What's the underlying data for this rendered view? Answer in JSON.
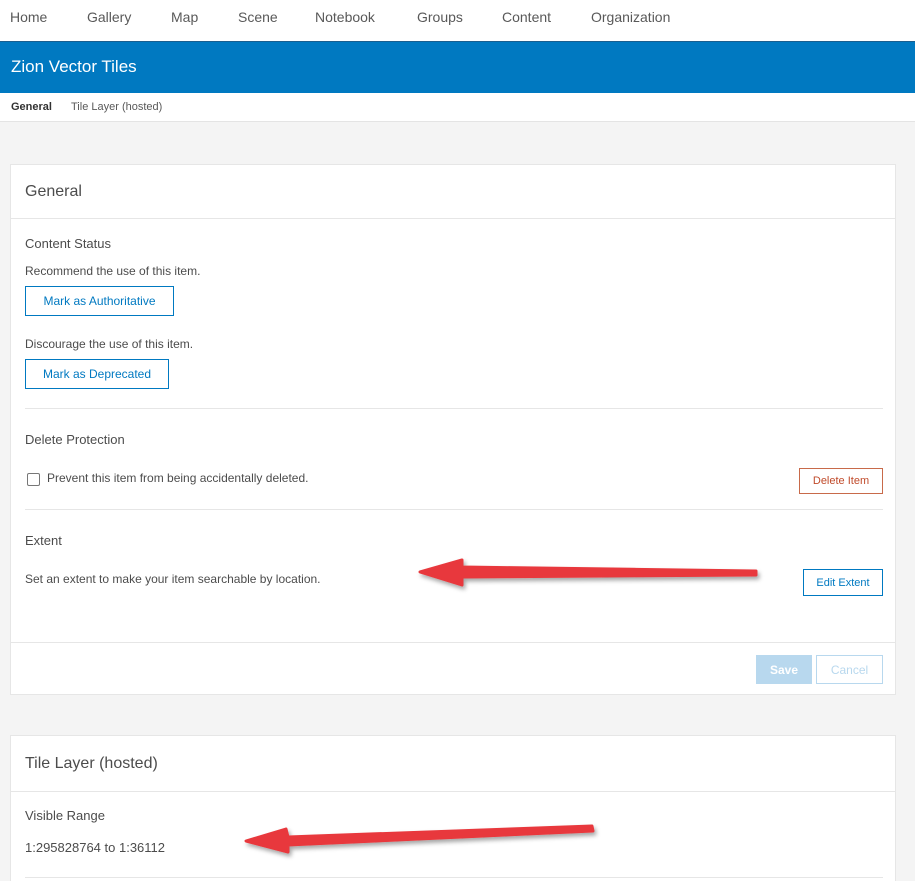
{
  "topnav": {
    "items": [
      "Home",
      "Gallery",
      "Map",
      "Scene",
      "Notebook",
      "Groups",
      "Content",
      "Organization"
    ]
  },
  "item": {
    "title": "Zion Vector Tiles"
  },
  "subnav": {
    "items": [
      "General",
      "Tile Layer (hosted)"
    ],
    "active": "General"
  },
  "general_panel": {
    "title": "General",
    "content_status": {
      "title": "Content Status",
      "recommend_text": "Recommend the use of this item.",
      "authoritative_label": "Mark as Authoritative",
      "discourage_text": "Discourage the use of this item.",
      "deprecated_label": "Mark as Deprecated"
    },
    "delete_protection": {
      "title": "Delete Protection",
      "checkbox_label": "Prevent this item from being accidentally deleted.",
      "checked": false,
      "delete_label": "Delete Item"
    },
    "extent": {
      "title": "Extent",
      "text": "Set an extent to make your item searchable by location.",
      "edit_label": "Edit Extent"
    },
    "footer": {
      "save_label": "Save",
      "cancel_label": "Cancel"
    }
  },
  "tile_panel": {
    "title": "Tile Layer (hosted)",
    "visible_range": {
      "title": "Visible Range",
      "value": "1:295828764 to 1:36112"
    }
  },
  "colors": {
    "brand": "#0079c1",
    "annotation_arrow": "#e8393c",
    "danger": "#c04a2a"
  },
  "annotations": [
    "red-arrow",
    "red-arrow"
  ]
}
